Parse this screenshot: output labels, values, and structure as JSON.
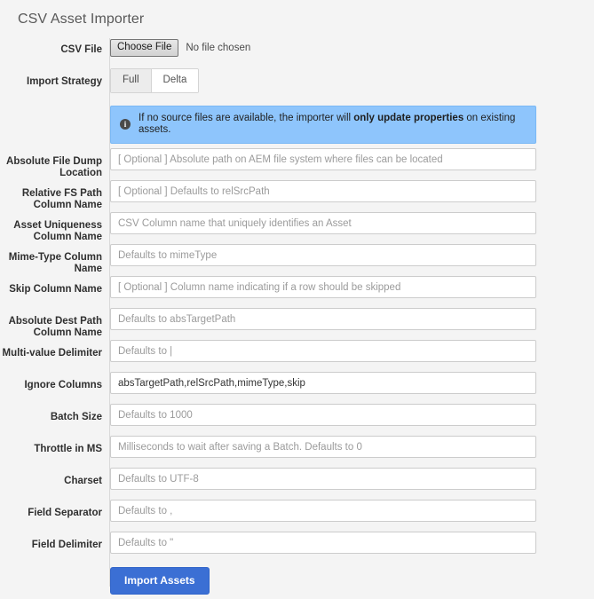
{
  "page": {
    "title": "CSV Asset Importer"
  },
  "colors": {
    "background": "#f4f4f4",
    "banner_bg": "#8ec5fc",
    "submit_bg": "#3b6fd4",
    "input_border": "#cccccc",
    "divider": "#d9d9d9"
  },
  "csv_file": {
    "label": "CSV File",
    "choose_button": "Choose File",
    "status": "No file chosen"
  },
  "import_strategy": {
    "label": "Import Strategy",
    "options": [
      {
        "label": "Full",
        "selected": true
      },
      {
        "label": "Delta",
        "selected": false
      }
    ]
  },
  "banner": {
    "icon": "info-icon",
    "text_before": "If no source files are available, the importer will ",
    "text_strong": "only update properties",
    "text_after": " on existing assets."
  },
  "fields": [
    {
      "label": "Absolute File Dump Location",
      "placeholder": "[ Optional ] Absolute path on AEM file system where files can be located",
      "value": ""
    },
    {
      "label": "Relative FS Path Column Name",
      "placeholder": "[ Optional ] Defaults to relSrcPath",
      "value": ""
    },
    {
      "label": "Asset Uniqueness Column Name",
      "placeholder": "CSV Column name that uniquely identifies an Asset",
      "value": ""
    },
    {
      "label": "Mime-Type Column Name",
      "placeholder": "Defaults to mimeType",
      "value": ""
    },
    {
      "label": "Skip Column Name",
      "placeholder": "[ Optional ] Column name indicating if a row should be skipped",
      "value": ""
    },
    {
      "label": "Absolute Dest Path Column Name",
      "placeholder": "Defaults to absTargetPath",
      "value": ""
    },
    {
      "label": "Multi-value Delimiter",
      "placeholder": "Defaults to |",
      "value": ""
    },
    {
      "label": "Ignore Columns",
      "placeholder": "",
      "value": "absTargetPath,relSrcPath,mimeType,skip"
    },
    {
      "label": "Batch Size",
      "placeholder": "Defaults to 1000",
      "value": ""
    },
    {
      "label": "Throttle in MS",
      "placeholder": "Milliseconds to wait after saving a Batch. Defaults to 0",
      "value": ""
    },
    {
      "label": "Charset",
      "placeholder": "Defaults to UTF-8",
      "value": ""
    },
    {
      "label": "Field Separator",
      "placeholder": "Defaults to ,",
      "value": ""
    },
    {
      "label": "Field Delimiter",
      "placeholder": "Defaults to \"",
      "value": ""
    }
  ],
  "submit": {
    "label": "Import Assets"
  }
}
